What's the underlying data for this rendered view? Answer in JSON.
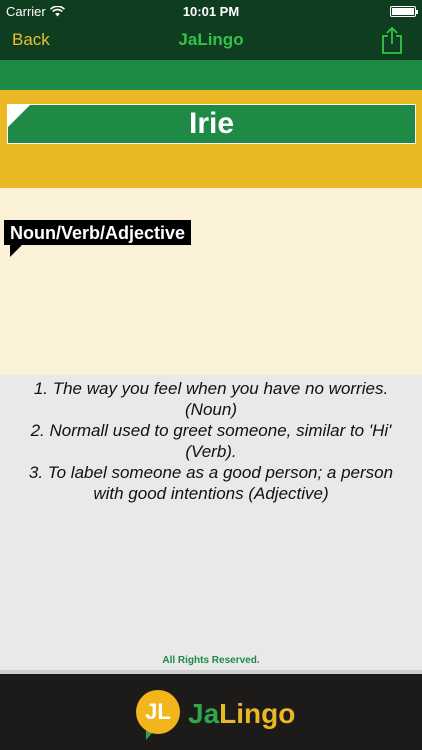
{
  "status_bar": {
    "carrier": "Carrier",
    "time": "10:01 PM",
    "icons": [
      "wifi-icon",
      "battery-icon"
    ]
  },
  "nav": {
    "back_label": "Back",
    "title": "JaLingo",
    "share_icon": "share-icon"
  },
  "entry": {
    "word": "Irie",
    "part_of_speech": "Noun/Verb/Adjective",
    "definitions": [
      "1. The way you feel when you have no worries. (Noun)",
      "2. Normall used to greet someone, similar to 'Hi' (Verb).",
      "3. To label someone as a good person; a person with good intentions (Adjective)"
    ]
  },
  "footer": {
    "rights": "All Rights Reserved.",
    "logo_badge": "JL",
    "logo_ja": "Ja",
    "logo_lingo": "Lingo"
  },
  "colors": {
    "dark_green": "#0f3d20",
    "green": "#1f8a45",
    "gold": "#e9b824",
    "cream": "#faf1d6",
    "footer_dark": "#1c1b1a"
  }
}
